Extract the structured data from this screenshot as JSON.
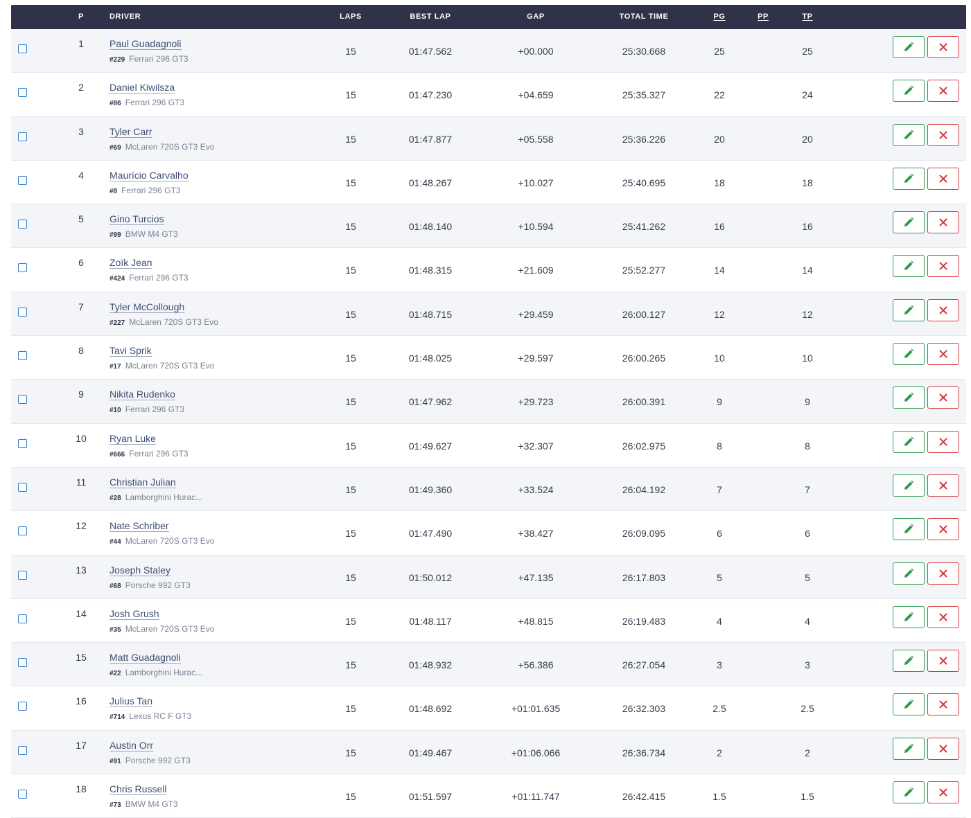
{
  "columns": {
    "p": "P",
    "driver": "DRIVER",
    "laps": "LAPS",
    "best_lap": "BEST LAP",
    "gap": "GAP",
    "total_time": "TOTAL TIME",
    "pg": "PG",
    "pp": "PP",
    "tp": "TP"
  },
  "colors": {
    "header_bg": "#2f3249",
    "edit_green": "#2e9b4f",
    "delete_red": "#d9363e",
    "checkbox_blue": "#2a7ad6"
  },
  "icons": {
    "edit": "pencil-icon",
    "delete": "close-icon"
  },
  "rows": [
    {
      "p": "1",
      "name": "Paul Guadagnoli",
      "num": "#229",
      "car": "Ferrari 296 GT3",
      "laps": "15",
      "best": "01:47.562",
      "gap": "+00.000",
      "total": "25:30.668",
      "pg": "25",
      "pp": "",
      "tp": "25"
    },
    {
      "p": "2",
      "name": "Daniel Kiwilsza",
      "num": "#86",
      "car": "Ferrari 296 GT3",
      "laps": "15",
      "best": "01:47.230",
      "gap": "+04.659",
      "total": "25:35.327",
      "pg": "22",
      "pp": "",
      "tp": "24"
    },
    {
      "p": "3",
      "name": "Tyler Carr",
      "num": "#69",
      "car": "McLaren 720S GT3 Evo",
      "laps": "15",
      "best": "01:47.877",
      "gap": "+05.558",
      "total": "25:36.226",
      "pg": "20",
      "pp": "",
      "tp": "20"
    },
    {
      "p": "4",
      "name": "Maurício Carvalho",
      "num": "#8",
      "car": "Ferrari 296 GT3",
      "laps": "15",
      "best": "01:48.267",
      "gap": "+10.027",
      "total": "25:40.695",
      "pg": "18",
      "pp": "",
      "tp": "18"
    },
    {
      "p": "5",
      "name": "Gino Turcios",
      "num": "#99",
      "car": "BMW M4 GT3",
      "laps": "15",
      "best": "01:48.140",
      "gap": "+10.594",
      "total": "25:41.262",
      "pg": "16",
      "pp": "",
      "tp": "16"
    },
    {
      "p": "6",
      "name": "Zoïk Jean",
      "num": "#424",
      "car": "Ferrari 296 GT3",
      "laps": "15",
      "best": "01:48.315",
      "gap": "+21.609",
      "total": "25:52.277",
      "pg": "14",
      "pp": "",
      "tp": "14"
    },
    {
      "p": "7",
      "name": "Tyler McCollough",
      "num": "#227",
      "car": "McLaren 720S GT3 Evo",
      "laps": "15",
      "best": "01:48.715",
      "gap": "+29.459",
      "total": "26:00.127",
      "pg": "12",
      "pp": "",
      "tp": "12"
    },
    {
      "p": "8",
      "name": "Tavi Sprik",
      "num": "#17",
      "car": "McLaren 720S GT3 Evo",
      "laps": "15",
      "best": "01:48.025",
      "gap": "+29.597",
      "total": "26:00.265",
      "pg": "10",
      "pp": "",
      "tp": "10"
    },
    {
      "p": "9",
      "name": "Nikita Rudenko",
      "num": "#10",
      "car": "Ferrari 296 GT3",
      "laps": "15",
      "best": "01:47.962",
      "gap": "+29.723",
      "total": "26:00.391",
      "pg": "9",
      "pp": "",
      "tp": "9"
    },
    {
      "p": "10",
      "name": "Ryan Luke",
      "num": "#666",
      "car": "Ferrari 296 GT3",
      "laps": "15",
      "best": "01:49.627",
      "gap": "+32.307",
      "total": "26:02.975",
      "pg": "8",
      "pp": "",
      "tp": "8"
    },
    {
      "p": "11",
      "name": "Christian Julian",
      "num": "#28",
      "car": "Lamborghini Hurac...",
      "laps": "15",
      "best": "01:49.360",
      "gap": "+33.524",
      "total": "26:04.192",
      "pg": "7",
      "pp": "",
      "tp": "7"
    },
    {
      "p": "12",
      "name": "Nate Schriber",
      "num": "#44",
      "car": "McLaren 720S GT3 Evo",
      "laps": "15",
      "best": "01:47.490",
      "gap": "+38.427",
      "total": "26:09.095",
      "pg": "6",
      "pp": "",
      "tp": "6"
    },
    {
      "p": "13",
      "name": "Joseph Staley",
      "num": "#68",
      "car": "Porsche 992 GT3",
      "laps": "15",
      "best": "01:50.012",
      "gap": "+47.135",
      "total": "26:17.803",
      "pg": "5",
      "pp": "",
      "tp": "5"
    },
    {
      "p": "14",
      "name": "Josh Grush",
      "num": "#35",
      "car": "McLaren 720S GT3 Evo",
      "laps": "15",
      "best": "01:48.117",
      "gap": "+48.815",
      "total": "26:19.483",
      "pg": "4",
      "pp": "",
      "tp": "4"
    },
    {
      "p": "15",
      "name": "Matt Guadagnoli",
      "num": "#22",
      "car": "Lamborghini Hurac...",
      "laps": "15",
      "best": "01:48.932",
      "gap": "+56.386",
      "total": "26:27.054",
      "pg": "3",
      "pp": "",
      "tp": "3"
    },
    {
      "p": "16",
      "name": "Julius Tan",
      "num": "#714",
      "car": "Lexus RC F GT3",
      "laps": "15",
      "best": "01:48.692",
      "gap": "+01:01.635",
      "total": "26:32.303",
      "pg": "2.5",
      "pp": "",
      "tp": "2.5"
    },
    {
      "p": "17",
      "name": "Austin Orr",
      "num": "#91",
      "car": "Porsche 992 GT3",
      "laps": "15",
      "best": "01:49.467",
      "gap": "+01:06.066",
      "total": "26:36.734",
      "pg": "2",
      "pp": "",
      "tp": "2"
    },
    {
      "p": "18",
      "name": "Chris Russell",
      "num": "#73",
      "car": "BMW M4 GT3",
      "laps": "15",
      "best": "01:51.597",
      "gap": "+01:11.747",
      "total": "26:42.415",
      "pg": "1.5",
      "pp": "",
      "tp": "1.5"
    }
  ]
}
